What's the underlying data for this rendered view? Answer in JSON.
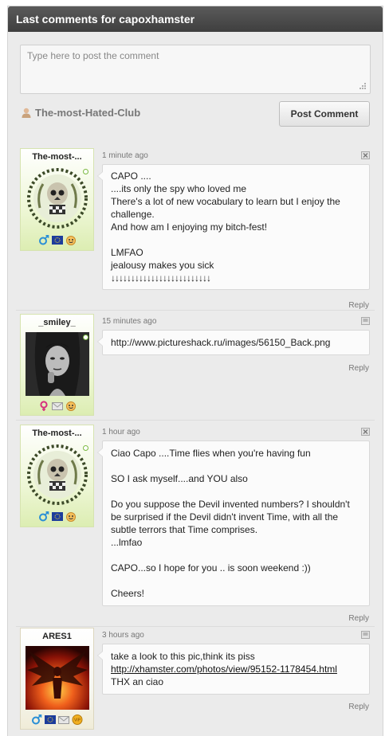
{
  "header": {
    "title": "Last comments for capoxhamster"
  },
  "composer": {
    "placeholder": "Type here to post the comment"
  },
  "poster": {
    "name": "The-most-Hated-Club"
  },
  "post_button": {
    "label": "Post Comment"
  },
  "comments": [
    {
      "username": "The-most-...",
      "online": true,
      "badges": [
        "male-icon",
        "eu-flag-icon",
        "emoji-icon"
      ],
      "time": "1 minute ago",
      "corner_icon": "close-icon",
      "lines": [
        "CAPO ....",
        "....its only the spy who loved me",
        "There's a lot of new vocabulary to learn but I enjoy the challenge.",
        "And how am I enjoying my bitch-fest!",
        "",
        "LMFAO",
        "jealousy makes you sick",
        "↓↓↓↓↓↓↓↓↓↓↓↓↓↓↓↓↓↓↓↓↓↓↓↓↓"
      ],
      "reply": "Reply"
    },
    {
      "username": "_smiley_",
      "online": true,
      "badges": [
        "female-icon",
        "mail-icon",
        "emoji-icon"
      ],
      "time": "15 minutes ago",
      "corner_icon": "message-icon",
      "lines": [
        "http://www.pictureshack.ru/images/56150_Back.png"
      ],
      "reply": "Reply"
    },
    {
      "username": "The-most-...",
      "online": true,
      "badges": [
        "male-icon",
        "eu-flag-icon",
        "emoji-icon"
      ],
      "time": "1 hour ago",
      "corner_icon": "close-icon",
      "lines": [
        "Ciao Capo ....Time flies when you're having fun",
        "",
        "SO I ask myself....and YOU also",
        "",
        "Do you suppose the Devil invented numbers? I shouldn't be surprised if the Devil didn't invent Time, with all the subtle terrors that Time comprises.",
        "...lmfao",
        "",
        "CAPO...so I hope for you .. is soon weekend :))",
        "",
        "Cheers!"
      ],
      "reply": "Reply"
    },
    {
      "username": "ARES1",
      "online": false,
      "badges": [
        "male-icon",
        "eu-flag-icon",
        "mail-icon",
        "vip-icon"
      ],
      "time": "3 hours ago",
      "corner_icon": "message-icon",
      "lines": [
        "take a look to this pic,think its piss"
      ],
      "link": "http://xhamster.com/photos/view/95152-1178454.html",
      "lines_after": [
        "THX an ciao"
      ],
      "reply": "Reply"
    }
  ],
  "colors": {
    "header_bg": "#4a4a4a",
    "online": "#7ab940",
    "card_green": "#dcedb2"
  }
}
